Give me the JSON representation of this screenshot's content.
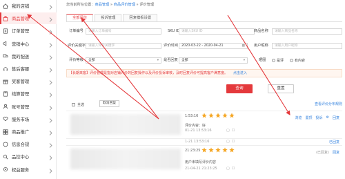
{
  "sidebar": {
    "items": [
      {
        "label": "我的店铺",
        "icon": "home-icon"
      },
      {
        "label": "商品管理",
        "icon": "bag-icon",
        "active": true
      },
      {
        "label": "订单管理",
        "icon": "document-icon"
      },
      {
        "label": "营销中心",
        "icon": "megaphone-icon"
      },
      {
        "label": "我的配送",
        "icon": "truck-icon"
      },
      {
        "label": "售后客服",
        "icon": "headset-icon"
      },
      {
        "label": "奖客管理",
        "icon": "gift-icon"
      },
      {
        "label": "结算管理",
        "icon": "calculator-icon"
      },
      {
        "label": "账号管理",
        "icon": "user-icon"
      },
      {
        "label": "服务市场",
        "icon": "heart-icon"
      },
      {
        "label": "商品推广",
        "icon": "grid-icon"
      },
      {
        "label": "信息合规",
        "icon": "shield-icon"
      },
      {
        "label": "品控中心",
        "icon": "search-icon"
      },
      {
        "label": "权益服务",
        "icon": "gear-icon"
      }
    ]
  },
  "breadcrumb": {
    "prefix": "您当前所在位置：",
    "items": [
      "商品管理",
      "商品评价管理",
      "评价管理"
    ],
    "separator": " » "
  },
  "tabs": [
    {
      "label": "全部评价",
      "active": true
    },
    {
      "label": "投诉管理",
      "active": false
    },
    {
      "label": "回复模板设置",
      "active": false
    }
  ],
  "filters": {
    "order_no_label": "订单编号",
    "order_no_placeholder": "请输入订单编号",
    "sku_label": "SKU ID",
    "sku_placeholder": "请输入SKU ID",
    "goods_name_label": "商品名称",
    "goods_name_placeholder": "请输入商品名称",
    "content_label": "评价关键字",
    "content_placeholder": "请输入评价关键字",
    "time_label": "评价时间",
    "time_value": "2020-03-22 - 2020-04-21",
    "user_label": "用户昵称",
    "user_placeholder": "请输入用户昵称",
    "level_label": "评价等级",
    "level_value": "全部",
    "reply_label": "是否回复",
    "reply_value": "全部",
    "pic_label": "晒图",
    "pic_option_1": "是评",
    "pic_option_2": "有内容"
  },
  "notice": {
    "text": "【长期来客】评价管理是指对店铺评价的回复操作以及评价投诉审核，及时回复评价可提高客户满意度。",
    "link": "点击进入"
  },
  "buttons": {
    "query": "查询",
    "reset": "重置"
  },
  "list": {
    "select_all": "全选",
    "batch_cancel": "取消回复",
    "rule_link": "查看评价分布规则"
  },
  "reviews": [
    {
      "time": "1:53:16",
      "stars": 5,
      "actions": [
        "浏览",
        "置顶",
        "投诉",
        "回复"
      ],
      "content_label": "评价内容：好",
      "sub_time": "01-21 13:53:16"
    },
    {
      "time": "1-21 13:53:16",
      "sub_time": "",
      "actions_right": "已回复"
    },
    {
      "time": "21:23:25",
      "stars": 5,
      "actions": [
        "投诉",
        "回复"
      ],
      "extra": "(已回复)",
      "content_label": "用户未填写评价内容",
      "sub_time": "21-04-21 21:23:25"
    }
  ],
  "colors": {
    "accent": "#e4393c",
    "link": "#2f7fdd",
    "star": "#f5a623"
  }
}
